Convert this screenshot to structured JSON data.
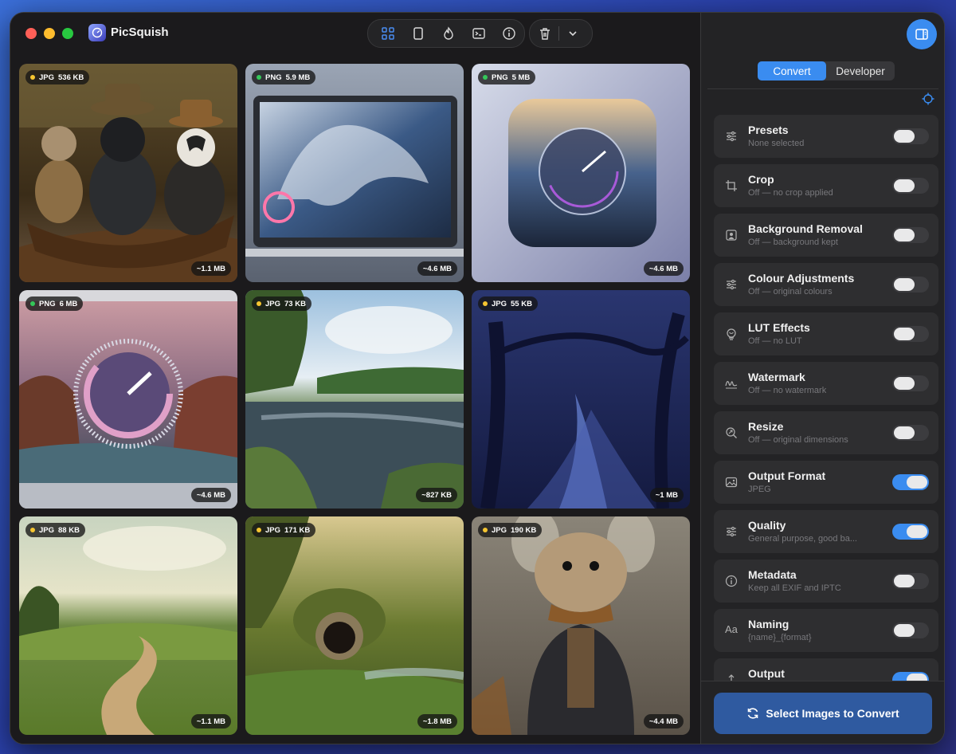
{
  "app": {
    "title": "PicSquish"
  },
  "toolbar": {
    "icons": [
      "grid-view-icon",
      "single-view-icon",
      "flame-icon",
      "terminal-icon",
      "info-icon",
      "trash-icon",
      "chevron-down-icon"
    ]
  },
  "images": [
    {
      "format": "JPG",
      "original": "536 KB",
      "estimate": "~1.1 MB",
      "dot": "jpg",
      "subject": "animals-in-boat"
    },
    {
      "format": "PNG",
      "original": "5.9 MB",
      "estimate": "~4.6 MB",
      "dot": "png",
      "subject": "laptop-wave"
    },
    {
      "format": "PNG",
      "original": "5 MB",
      "estimate": "~4.6 MB",
      "dot": "png",
      "subject": "app-icon-wave"
    },
    {
      "format": "PNG",
      "original": "6 MB",
      "estimate": "~4.6 MB",
      "dot": "png",
      "subject": "laptop-gauge"
    },
    {
      "format": "JPG",
      "original": "73 KB",
      "estimate": "~827 KB",
      "dot": "jpg",
      "subject": "lake"
    },
    {
      "format": "JPG",
      "original": "55 KB",
      "estimate": "~1 MB",
      "dot": "jpg",
      "subject": "blue-forest"
    },
    {
      "format": "JPG",
      "original": "88 KB",
      "estimate": "~1.1 MB",
      "dot": "jpg",
      "subject": "country-road"
    },
    {
      "format": "JPG",
      "original": "171 KB",
      "estimate": "~1.8 MB",
      "dot": "jpg",
      "subject": "hobbit-hole"
    },
    {
      "format": "JPG",
      "original": "190 KB",
      "estimate": "~4.4 MB",
      "dot": "jpg",
      "subject": "mouse-in-coat"
    }
  ],
  "sidebar": {
    "tabs": [
      {
        "label": "Convert",
        "active": true
      },
      {
        "label": "Developer",
        "active": false
      }
    ],
    "settings": [
      {
        "title": "Presets",
        "subtitle": "None selected",
        "on": false,
        "icon": "sliders-icon"
      },
      {
        "title": "Crop",
        "subtitle": "Off — no crop applied",
        "on": false,
        "icon": "crop-icon"
      },
      {
        "title": "Background Removal",
        "subtitle": "Off — background kept",
        "on": false,
        "icon": "person-icon"
      },
      {
        "title": "Colour Adjustments",
        "subtitle": "Off — original colours",
        "on": false,
        "icon": "sliders-icon"
      },
      {
        "title": "LUT Effects",
        "subtitle": "Off — no LUT",
        "on": false,
        "icon": "lut-icon"
      },
      {
        "title": "Watermark",
        "subtitle": "Off — no watermark",
        "on": false,
        "icon": "signature-icon"
      },
      {
        "title": "Resize",
        "subtitle": "Off — original dimensions",
        "on": false,
        "icon": "resize-icon"
      },
      {
        "title": "Output Format",
        "subtitle": "JPEG",
        "on": true,
        "icon": "image-icon"
      },
      {
        "title": "Quality",
        "subtitle": "General purpose, good ba...",
        "on": true,
        "icon": "sliders-icon"
      },
      {
        "title": "Metadata",
        "subtitle": "Keep all EXIF and IPTC",
        "on": false,
        "icon": "info-icon"
      },
      {
        "title": "Naming",
        "subtitle": "{name}_{format}",
        "on": false,
        "icon": "text-aa-icon"
      },
      {
        "title": "Output",
        "subtitle": "",
        "on": true,
        "icon": "export-icon"
      }
    ],
    "primary_action": "Select Images to Convert"
  },
  "colors": {
    "accent": "#3a8cf0",
    "jpg_dot": "#f5c531",
    "png_dot": "#34c759"
  }
}
